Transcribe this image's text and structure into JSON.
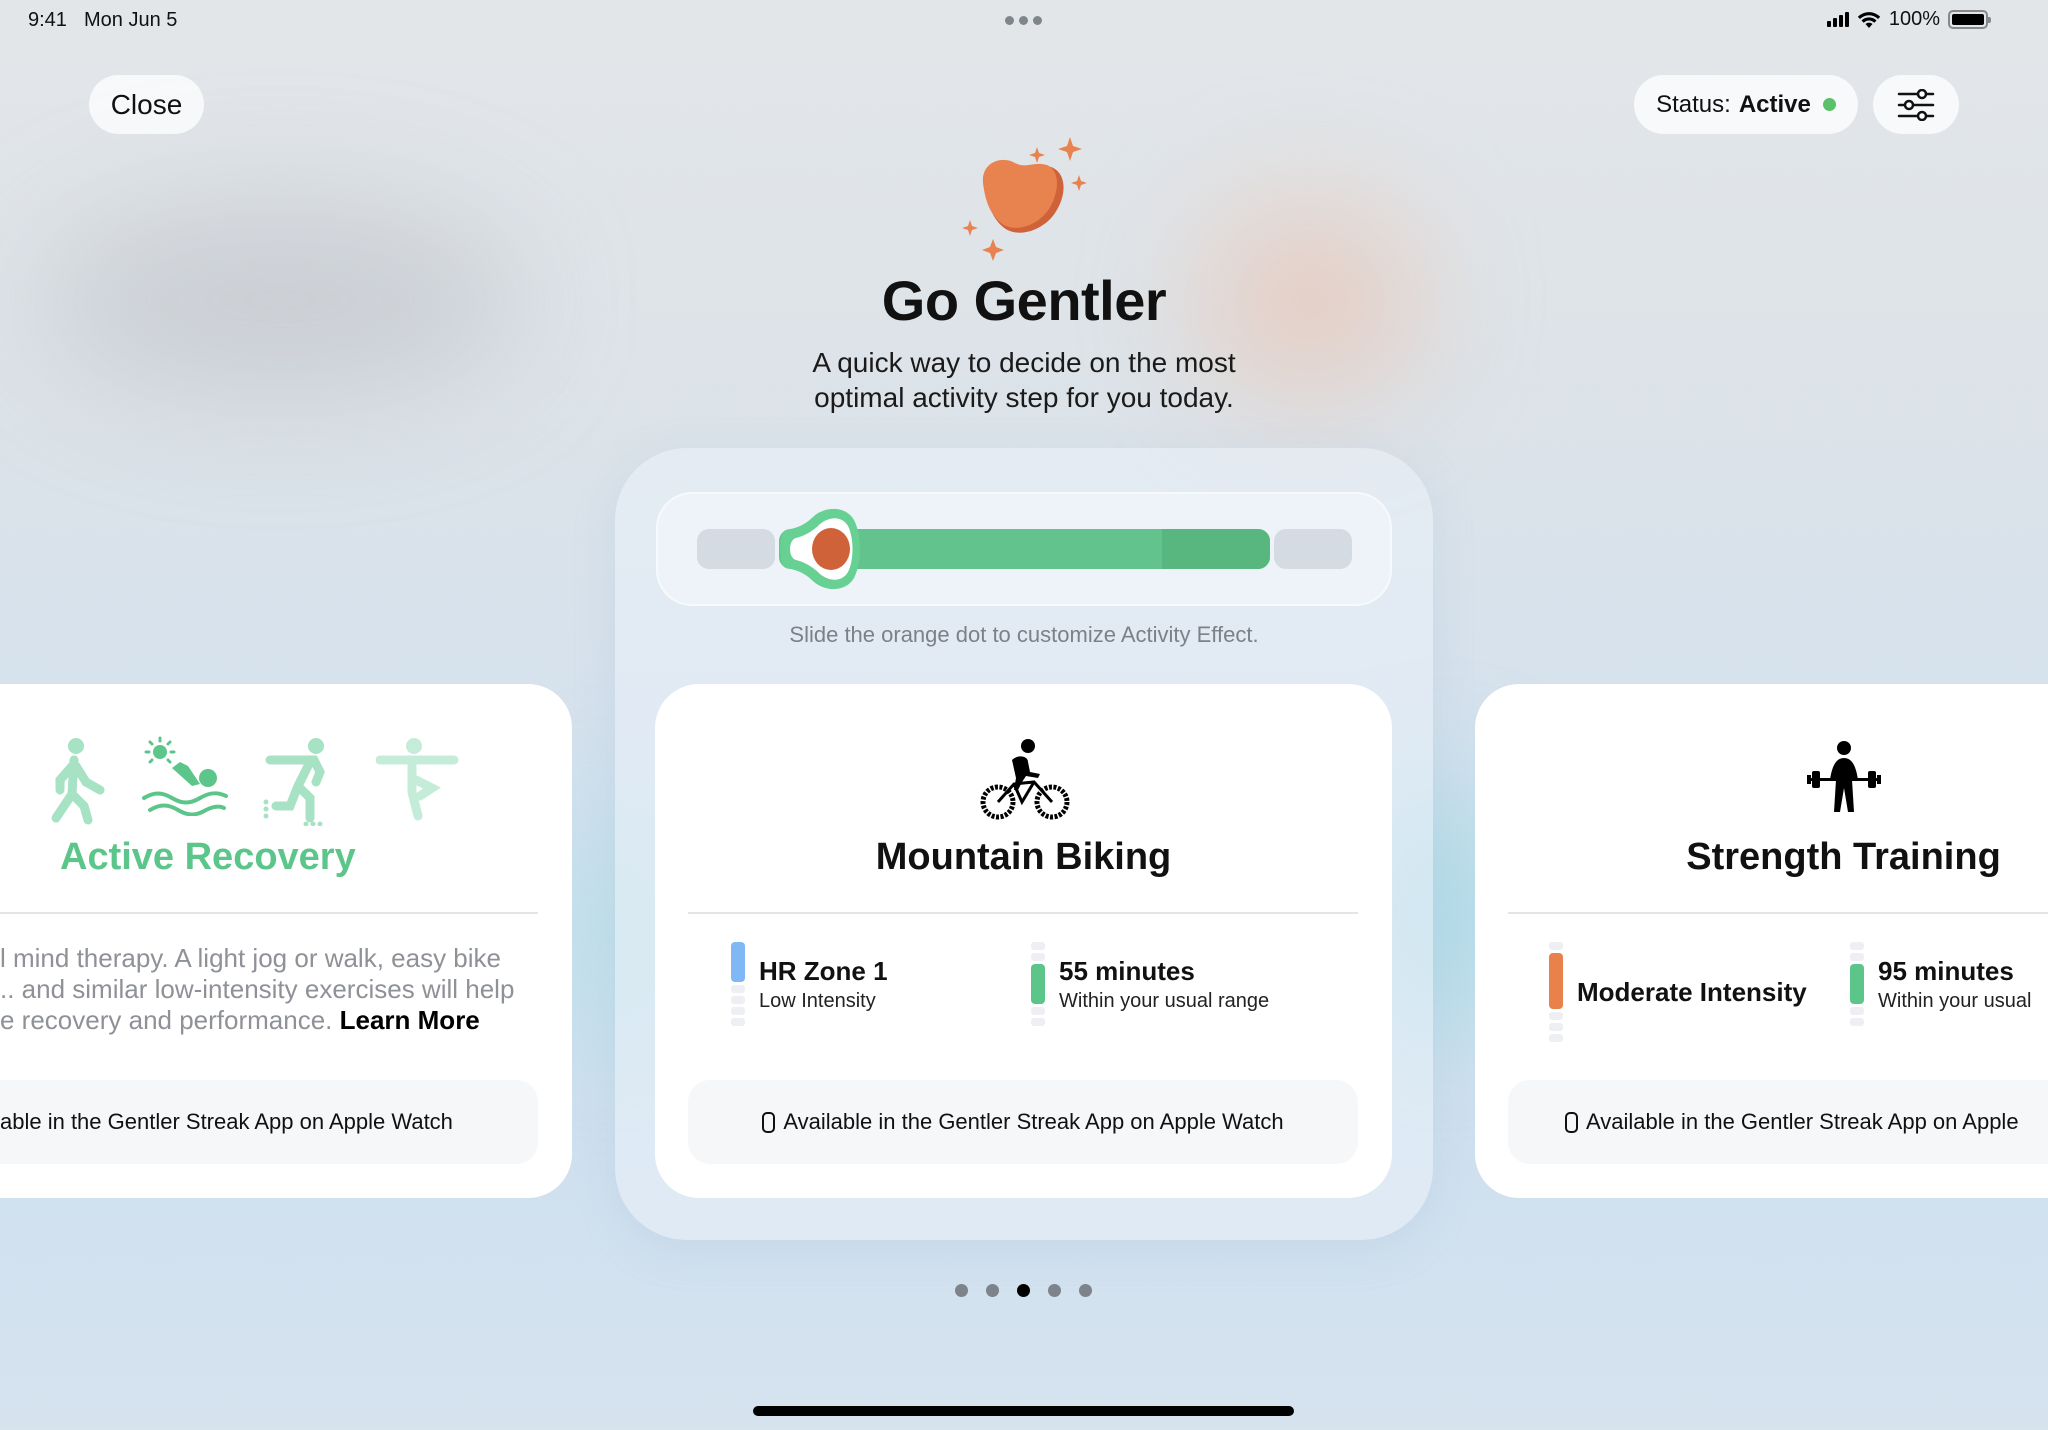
{
  "status_bar": {
    "time": "9:41",
    "date": "Mon Jun 5",
    "battery": "100%",
    "battery_level_percent": 100,
    "signal_bars": 4
  },
  "header_buttons": {
    "close_label": "Close",
    "status_label": "Status:",
    "status_value": "Active",
    "status_color": "#5ac16a",
    "filter_icon": "sliders-icon"
  },
  "hero": {
    "icon": "heart-sparkles-icon",
    "title": "Go Gentler",
    "subtitle_line1": "A quick way to decide on the most",
    "subtitle_line2": "optimal activity step for you today."
  },
  "slider": {
    "hint": "Slide the orange dot to customize Activity Effect.",
    "knob_color": "#d0623a",
    "track_color": "#62c48c",
    "track_highlight_color": "#58b77f",
    "value_position": 0.05,
    "highlight_fraction": 0.22
  },
  "cards": [
    {
      "title": "Active Recovery",
      "title_color": "#5cc68a",
      "icons": [
        "walking-icon",
        "swimming-icon",
        "rollerskating-icon",
        "yoga-icon"
      ],
      "description_line1": "l mind therapy. A light jog or walk, easy bike",
      "description_line2": ".. and similar low-intensity exercises will help",
      "description_line3": "e recovery and performance.",
      "learn_more": "Learn More",
      "footer": "able in the Gentler Streak App on Apple Watch"
    },
    {
      "title": "Mountain Biking",
      "icon": "bicycle-icon",
      "stats": [
        {
          "main": "HR Zone 1",
          "sub": "Low Intensity",
          "color": "#7fb8f5",
          "segments": 5,
          "active_segment": 0
        },
        {
          "main": "55 minutes",
          "sub": "Within your usual range",
          "color": "#5cc68a",
          "segments": 5,
          "active_segment": 2
        }
      ],
      "footer": "Available in the Gentler Streak App on Apple Watch"
    },
    {
      "title": "Strength Training",
      "icon": "weightlifting-icon",
      "stats": [
        {
          "main": "Moderate Intensity",
          "sub": "",
          "color": "#e8824a",
          "segments": 5,
          "active_segment": 1
        },
        {
          "main": "95 minutes",
          "sub": "Within your usual",
          "color": "#5cc68a",
          "segments": 5,
          "active_segment": 2
        }
      ],
      "footer": "Available in the Gentler Streak App on Apple"
    }
  ],
  "pagination": {
    "count": 5,
    "active_index": 2
  }
}
